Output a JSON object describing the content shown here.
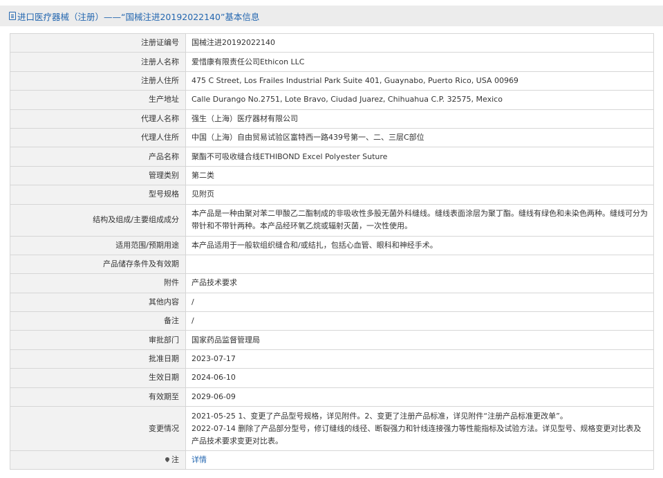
{
  "header": {
    "title": "进口医疗器械（注册）——“国械注进20192022140”基本信息",
    "icon": "document-icon"
  },
  "rows": [
    {
      "label": "注册证编号",
      "value": "国械注进20192022140"
    },
    {
      "label": "注册人名称",
      "value": "爱惜康有限责任公司Ethicon LLC"
    },
    {
      "label": "注册人住所",
      "value": "475 C Street, Los Frailes Industrial Park Suite 401, Guaynabo, Puerto Rico, USA 00969"
    },
    {
      "label": "生产地址",
      "value": "Calle Durango No.2751, Lote Bravo, Ciudad Juarez, Chihuahua C.P. 32575, Mexico"
    },
    {
      "label": "代理人名称",
      "value": "强生（上海）医疗器材有限公司"
    },
    {
      "label": "代理人住所",
      "value": "中国（上海）自由贸易试验区富特西一路439号第一、二、三层C部位"
    },
    {
      "label": "产品名称",
      "value": "聚酯不可吸收缝合线ETHIBOND Excel Polyester Suture"
    },
    {
      "label": "管理类别",
      "value": "第二类"
    },
    {
      "label": "型号规格",
      "value": "见附页"
    },
    {
      "label": "结构及组成/主要组成成分",
      "value": "本产品是一种由聚对苯二甲酸乙二酯制成的非吸收性多股无菌外科缝线。缝线表面涂层为聚丁酯。缝线有绿色和未染色两种。缝线可分为带针和不带针两种。本产品经环氧乙烷或辐射灭菌，一次性使用。"
    },
    {
      "label": "适用范围/预期用途",
      "value": "本产品适用于一般软组织缝合和/或结扎，包括心血管、眼科和神经手术。"
    },
    {
      "label": "产品储存条件及有效期",
      "value": ""
    },
    {
      "label": "附件",
      "value": "产品技术要求"
    },
    {
      "label": "其他内容",
      "value": "/"
    },
    {
      "label": "备注",
      "value": "/"
    },
    {
      "label": "审批部门",
      "value": "国家药品监督管理局"
    },
    {
      "label": "批准日期",
      "value": "2023-07-17"
    },
    {
      "label": "生效日期",
      "value": "2024-06-10"
    },
    {
      "label": "有效期至",
      "value": "2029-06-09"
    },
    {
      "label": "变更情况",
      "value_lines": [
        "2021-05-25 1、变更了产品型号规格，详见附件。2、变更了注册产品标准，详见附件“注册产品标准更改单”。",
        "2022-07-14 删除了产品部分型号，修订缝线的线径、断裂强力和针线连接强力等性能指标及试验方法。详见型号、规格变更对比表及产品技术要求变更对比表。"
      ]
    },
    {
      "label": "注",
      "value": "详情",
      "label_icon": "location-pin-icon"
    }
  ]
}
